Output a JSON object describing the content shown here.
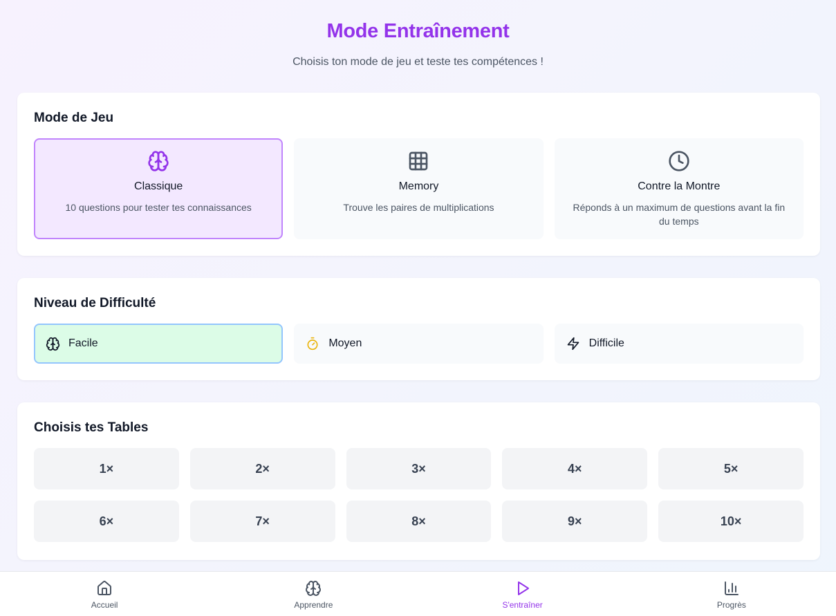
{
  "header": {
    "title": "Mode Entraînement",
    "subtitle": "Choisis ton mode de jeu et teste tes compétences !"
  },
  "mode_section": {
    "title": "Mode de Jeu",
    "options": [
      {
        "title": "Classique",
        "description": "10 questions pour tester tes connaissances",
        "icon": "brain-icon",
        "selected": true
      },
      {
        "title": "Memory",
        "description": "Trouve les paires de multiplications",
        "icon": "grid-icon",
        "selected": false
      },
      {
        "title": "Contre la Montre",
        "description": "Réponds à un maximum de questions avant la fin du temps",
        "icon": "clock-icon",
        "selected": false
      }
    ]
  },
  "difficulty_section": {
    "title": "Niveau de Difficulté",
    "options": [
      {
        "label": "Facile",
        "icon": "brain-icon",
        "selected": true
      },
      {
        "label": "Moyen",
        "icon": "timer-icon",
        "selected": false
      },
      {
        "label": "Difficile",
        "icon": "lightning-icon",
        "selected": false
      }
    ]
  },
  "tables_section": {
    "title": "Choisis tes Tables",
    "tables": [
      "1×",
      "2×",
      "3×",
      "4×",
      "5×",
      "6×",
      "7×",
      "8×",
      "9×",
      "10×"
    ]
  },
  "nav": {
    "items": [
      {
        "label": "Accueil",
        "icon": "home-icon",
        "active": false
      },
      {
        "label": "Apprendre",
        "icon": "brain-icon",
        "active": false
      },
      {
        "label": "S'entraîner",
        "icon": "play-icon",
        "active": true
      },
      {
        "label": "Progrès",
        "icon": "bar-chart-icon",
        "active": false
      }
    ]
  },
  "colors": {
    "accent": "#9333ea",
    "selected_mode_bg": "#f3e8ff",
    "selected_mode_border": "#c084fc",
    "selected_difficulty_bg": "#dcfce7",
    "selected_difficulty_border": "#93c5fd",
    "timer_icon": "#eab308"
  }
}
